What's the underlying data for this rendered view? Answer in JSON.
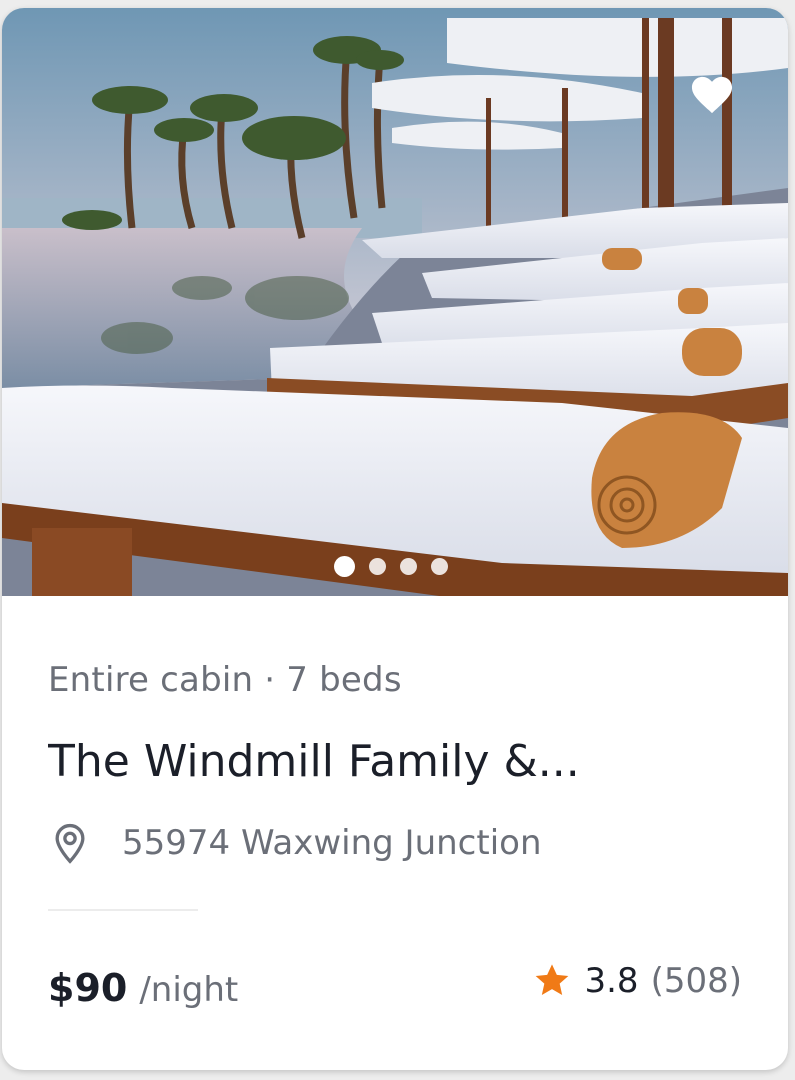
{
  "listing": {
    "subtitle": "Entire cabin · 7 beds",
    "title": "The Windmill Family &...",
    "location": "55974 Waxwing Junction",
    "price": "$90",
    "price_unit": "/night",
    "rating": "3.8",
    "reviews": "(508)",
    "favorited": false,
    "image_count": 4,
    "active_image": 1
  },
  "icons": {
    "favorite": "heart-icon",
    "location": "map-pin-icon",
    "rating": "star-icon"
  },
  "colors": {
    "star": "#f07a16",
    "text_primary": "#1b1f29",
    "text_secondary": "#6b6f78"
  }
}
